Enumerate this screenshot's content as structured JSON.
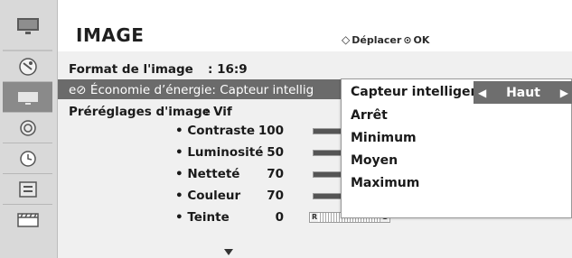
{
  "sidebar": {
    "icons": [
      "tv-icon",
      "satellite-dish-icon",
      "picture-icon",
      "audio-icon",
      "clock-icon",
      "option-icon",
      "media-icon"
    ]
  },
  "header": {
    "title": "IMAGE",
    "hint_move": "Déplacer",
    "hint_ok": "OK"
  },
  "menu": {
    "format_label": "Format de l'image",
    "format_value": ": 16:9",
    "energy_label": "Économie d’énergie: Capteur intellig",
    "preset_label": "Préréglages d'image",
    "preset_value": ": Vif",
    "settings": [
      {
        "name": "• Contraste",
        "value": "100",
        "level": 1.0
      },
      {
        "name": "• Luminosité",
        "value": "50",
        "level": 0.5
      },
      {
        "name": "• Netteté",
        "value": "70",
        "level": 0.7
      },
      {
        "name": "• Couleur",
        "value": "70",
        "level": 0.7
      },
      {
        "name": "• Teinte",
        "value": "0"
      }
    ],
    "tint_left": "R",
    "tint_right": "G"
  },
  "popup": {
    "current_label": "Capteur intelligent",
    "current_value": "Haut",
    "options": [
      "Arrêt",
      "Minimum",
      "Moyen",
      "Maximum"
    ]
  }
}
